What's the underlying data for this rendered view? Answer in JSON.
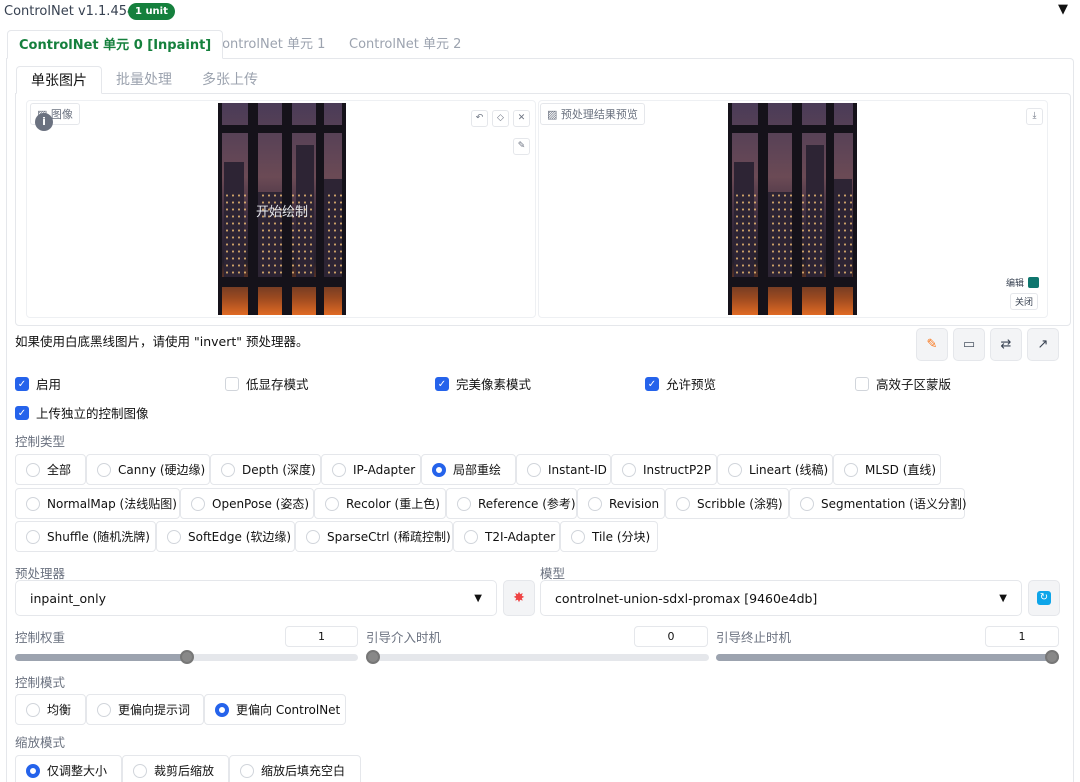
{
  "header": {
    "title": "ControlNet v1.1.454",
    "badge": "1 unit",
    "collapse_icon": "▼"
  },
  "unit_tabs": [
    "ControlNet 单元 0 [Inpaint]",
    "ControlNet 单元 1",
    "ControlNet 单元 2"
  ],
  "image_tabs": [
    "单张图片",
    "批量处理",
    "多张上传"
  ],
  "image_area": {
    "input_label": "图像",
    "canvas_hint": "开始绘制",
    "preview_label": "预处理结果预览",
    "edit_label": "编辑",
    "close_label": "关闭",
    "tool_icons": [
      "undo-icon",
      "eraser-icon",
      "close-icon",
      "brush-icon",
      "download-icon"
    ]
  },
  "note": "如果使用白底黑线图片，请使用 \"invert\" 预处理器。",
  "action_icons": [
    "edit-icon",
    "camera-icon",
    "swap-icon",
    "send-icon"
  ],
  "checkboxes": {
    "enable": "启用",
    "low_vram": "低显存模式",
    "pixel_perfect": "完美像素模式",
    "allow_preview": "允许预览",
    "efficient_mask": "高效子区蒙版",
    "upload_independent": "上传独立的控制图像"
  },
  "control_type": {
    "label": "控制类型",
    "options": [
      "全部",
      "Canny (硬边缘)",
      "Depth (深度)",
      "IP-Adapter",
      "局部重绘",
      "Instant-ID",
      "InstructP2P",
      "Lineart (线稿)",
      "MLSD (直线)",
      "NormalMap (法线贴图)",
      "OpenPose (姿态)",
      "Recolor (重上色)",
      "Reference (参考)",
      "Revision",
      "Scribble (涂鸦)",
      "Segmentation (语义分割)",
      "Shuffle (随机洗牌)",
      "SoftEdge (软边缘)",
      "SparseCtrl (稀疏控制)",
      "T2I-Adapter",
      "Tile (分块)"
    ],
    "selected": "局部重绘"
  },
  "preprocessor": {
    "label": "预处理器",
    "value": "inpaint_only"
  },
  "model": {
    "label": "模型",
    "value": "controlnet-union-sdxl-promax [9460e4db]"
  },
  "sliders": {
    "weight": {
      "label": "控制权重",
      "value": "1",
      "fraction": 0.5
    },
    "start": {
      "label": "引导介入时机",
      "value": "0",
      "fraction": 0.0
    },
    "end": {
      "label": "引导终止时机",
      "value": "1",
      "fraction": 1.0
    }
  },
  "control_mode": {
    "label": "控制模式",
    "options": [
      "均衡",
      "更偏向提示词",
      "更偏向 ControlNet"
    ],
    "selected": "更偏向 ControlNet"
  },
  "resize_mode": {
    "label": "缩放模式",
    "options": [
      "仅调整大小",
      "裁剪后缩放",
      "缩放后填充空白"
    ],
    "selected": "仅调整大小"
  },
  "colors": {
    "accent": "#2563eb",
    "badge": "#15803d",
    "active_tab": "#15803d"
  }
}
